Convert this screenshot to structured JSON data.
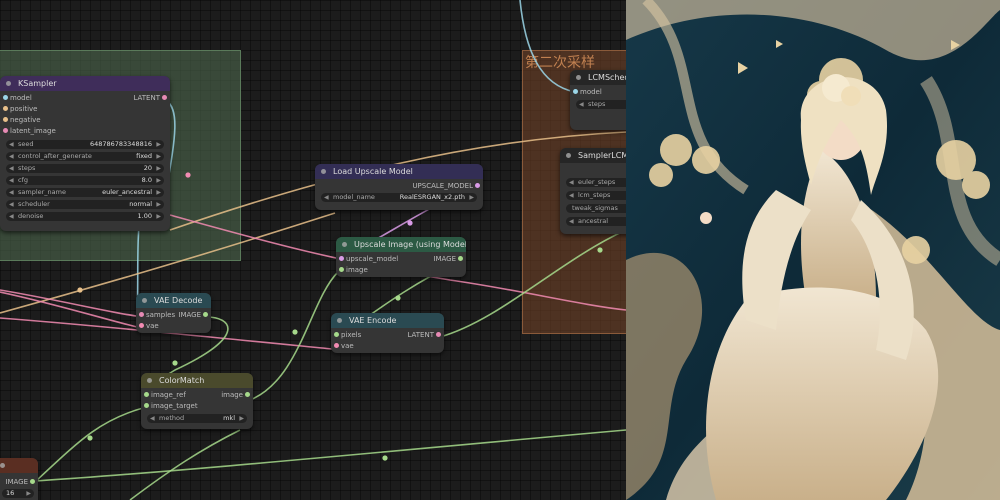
{
  "groups": {
    "second_sampling": "第二次采样"
  },
  "colors": {
    "latent": "#e68ab4",
    "model": "#9bd6e8",
    "conditioning": "#e8c08a",
    "image": "#a6d98b",
    "vae": "#f28bb2",
    "upscale_model": "#d99be6"
  },
  "nodes": {
    "ksampler": {
      "title": "KSampler",
      "inputs": [
        "model",
        "positive",
        "negative",
        "latent_image"
      ],
      "output": "LATENT",
      "widgets": [
        {
          "label": "seed",
          "value": "648786783348816"
        },
        {
          "label": "control_after_generate",
          "value": "fixed"
        },
        {
          "label": "steps",
          "value": "20"
        },
        {
          "label": "cfg",
          "value": "8.0"
        },
        {
          "label": "sampler_name",
          "value": "euler_ancestral"
        },
        {
          "label": "scheduler",
          "value": "normal"
        },
        {
          "label": "denoise",
          "value": "1.00"
        }
      ]
    },
    "load_upscale_model": {
      "title": "Load Upscale Model",
      "output": "UPSCALE_MODEL",
      "widget": {
        "label": "model_name",
        "value": "RealESRGAN_x2.pth"
      }
    },
    "upscale_image": {
      "title": "Upscale Image (using Model)",
      "inputs": [
        "upscale_model",
        "image"
      ],
      "output": "IMAGE"
    },
    "vae_decode": {
      "title": "VAE Decode",
      "inputs": [
        "samples",
        "vae"
      ],
      "output": "IMAGE"
    },
    "vae_encode": {
      "title": "VAE Encode",
      "inputs": [
        "pixels",
        "vae"
      ],
      "output": "LATENT"
    },
    "color_match": {
      "title": "ColorMatch",
      "inputs": [
        "image_ref",
        "image_target"
      ],
      "output": "image",
      "widget": {
        "label": "method",
        "value": "mkl"
      }
    },
    "lcm_scheduler": {
      "title": "LCMSchedu",
      "input": "model",
      "widget": {
        "label": "steps"
      }
    },
    "sampler_lcm": {
      "title": "SamplerLCMC",
      "widgets": [
        {
          "label": "euler_steps"
        },
        {
          "label": "lcm_steps"
        },
        {
          "label": "tweak_sigmas"
        },
        {
          "label": "ancestral"
        }
      ]
    },
    "bottom_left": {
      "output": "IMAGE",
      "value": "16"
    }
  },
  "artwork": {
    "subject": "anime-woman-with-flowers"
  }
}
